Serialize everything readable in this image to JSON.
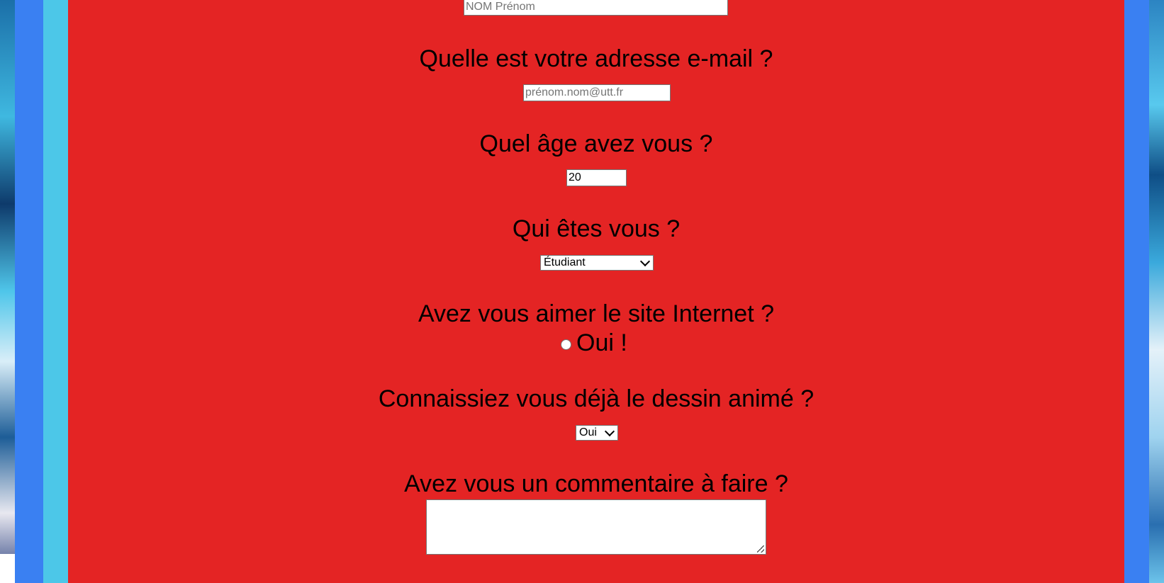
{
  "form": {
    "name": {
      "placeholder": "NOM Prénom"
    },
    "email": {
      "question": "Quelle est votre adresse e-mail ?",
      "placeholder": "prénom.nom@utt.fr"
    },
    "age": {
      "question": "Quel âge avez vous ?",
      "value": "20"
    },
    "who": {
      "question": "Qui êtes vous ?",
      "selected": "Étudiant"
    },
    "liked": {
      "question": "Avez vous aimer le site Internet ?",
      "option_label": "Oui !"
    },
    "known": {
      "question": "Connaissiez vous déjà le dessin animé ?",
      "selected": "Oui"
    },
    "comment": {
      "question": "Avez vous un commentaire à faire ?",
      "value": ""
    }
  },
  "colors": {
    "panel": "#e42424",
    "frame": "#3a80f2",
    "border": "#4cc7e8"
  }
}
